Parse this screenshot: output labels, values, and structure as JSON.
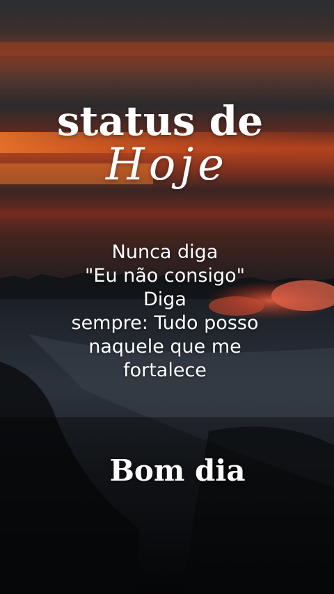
{
  "title": {
    "line1": "status de",
    "line2": "Hoje"
  },
  "quote": {
    "lines": [
      "Nunca diga",
      "\"Eu não consigo\"",
      "Diga",
      "sempre: Tudo posso",
      "naquele que me",
      "fortalece"
    ]
  },
  "greeting": "Bom dia",
  "colors": {
    "text": "#ffffff",
    "sky_top": "#2b2f35",
    "sky_band_orange": "#d2542a",
    "sky_band_red": "#8a2415",
    "ground_dark": "#0c0e12",
    "snow": "#5c6470"
  }
}
